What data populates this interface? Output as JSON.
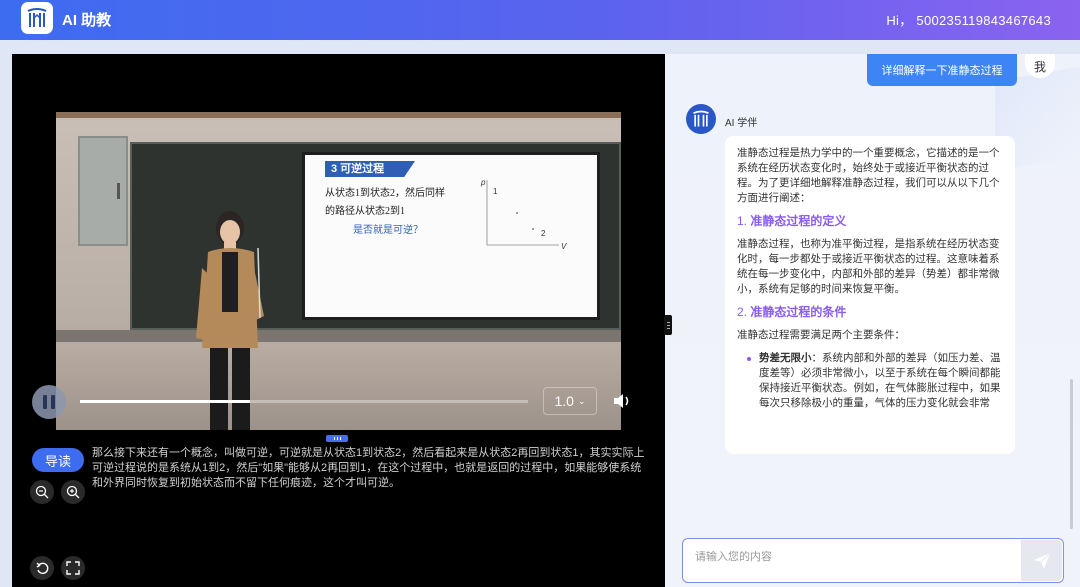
{
  "header": {
    "app_title": "AI 助教",
    "greeting": "Hi， 500235119843467643"
  },
  "video": {
    "slide": {
      "title": "3 可逆过程",
      "line1": "从状态1到状态2，然后同样",
      "line2": "的路径从状态2到1",
      "question": "是否就是可逆？",
      "graph_p": "p",
      "graph_v": "V",
      "graph_1": "1",
      "graph_2": "2"
    },
    "progress": 0.38,
    "speed_label": "1.0",
    "guide_label": "导读",
    "transcript": "那么接下来还有一个概念，叫做可逆，可逆就是从状态1到状态2，然后看起来是从状态2再回到状态1，其实实际上可逆过程说的是系统从1到2，然后\"如果\"能够从2再回到1，在这个过程中，也就是返回的过程中，如果能够使系统和外界同时恢复到初始状态而不留下任何痕迹，这个才叫可逆。"
  },
  "chat": {
    "user_message": "详细解释一下准静态过程",
    "user_avatar_label": "我",
    "ai_name": "AI 学伴",
    "ai_intro": "准静态过程是热力学中的一个重要概念，它描述的是一个系统在经历状态变化时，始终处于或接近平衡状态的过程。为了更详细地解释准静态过程，我们可以从以下几个方面进行阐述：",
    "section1_num": "1.",
    "section1_title": "准静态过程的定义",
    "section1_body": "准静态过程，也称为准平衡过程，是指系统在经历状态变化时，每一步都处于或接近平衡状态的过程。这意味着系统在每一步变化中，内部和外部的差异（势差）都非常微小，系统有足够的时间来恢复平衡。",
    "section2_num": "2.",
    "section2_title": "准静态过程的条件",
    "section2_body": "准静态过程需要满足两个主要条件：",
    "bullet1_title": "势差无限小",
    "bullet1_body": "：系统内部和外部的差异（如压力差、温度差等）必须非常微小，以至于系统在每个瞬间都能保持接近平衡状态。例如，在气体膨胀过程中，如果每次只移除极小的重量，气体的压力变化就会非常",
    "input_placeholder": "请输入您的内容"
  },
  "colors": {
    "accent": "#3d6cf0",
    "heading": "#8a5cf0"
  }
}
